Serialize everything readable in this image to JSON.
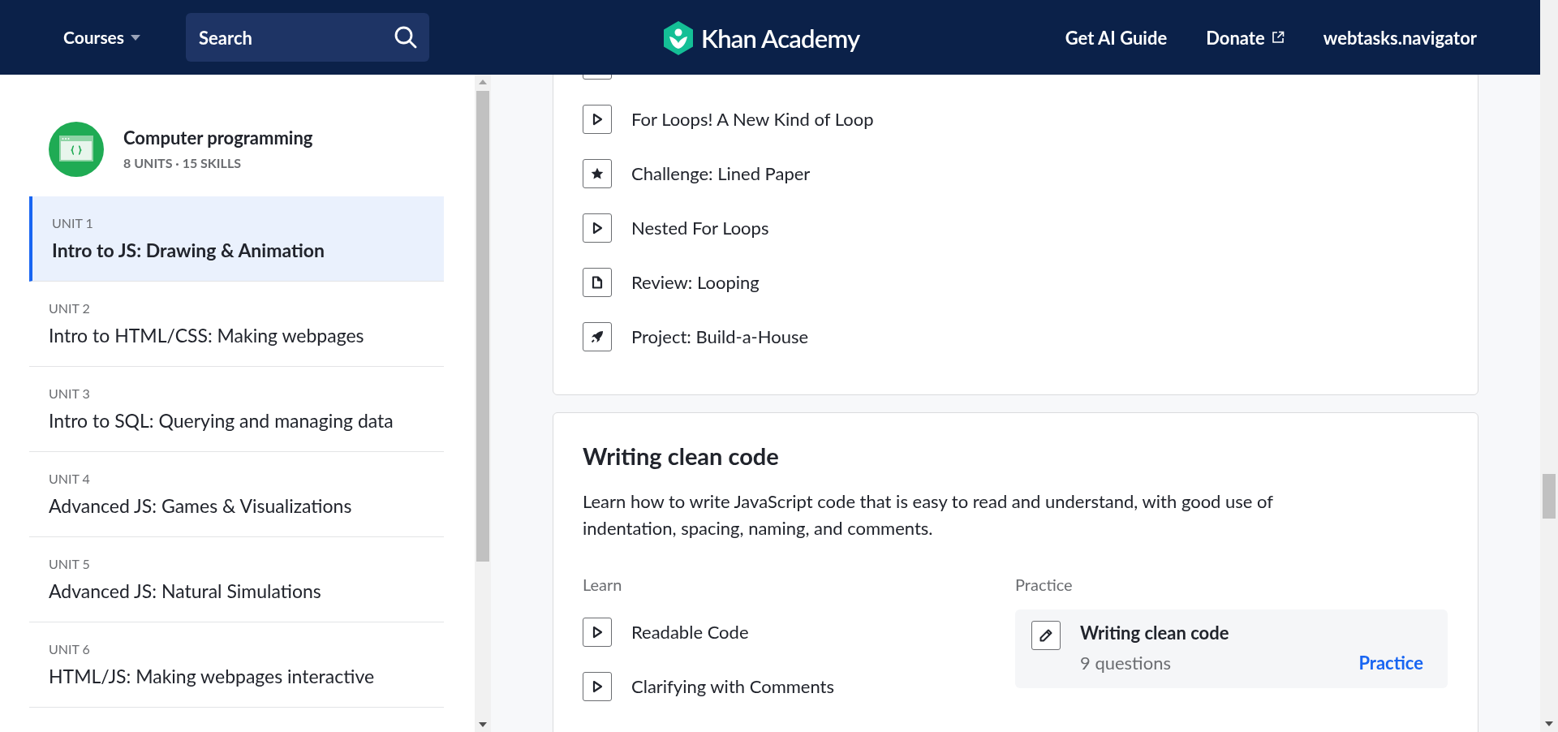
{
  "header": {
    "courses_label": "Courses",
    "search": {
      "placeholder": "Search"
    },
    "logo_text": "Khan Academy",
    "links": [
      {
        "label": "Get AI Guide",
        "external": false
      },
      {
        "label": "Donate",
        "external": true
      },
      {
        "label": "webtasks.navigator",
        "external": false
      }
    ]
  },
  "sidebar": {
    "course_title": "Computer programming",
    "course_meta": "8 UNITS · 15 SKILLS",
    "units": [
      {
        "label": "UNIT 1",
        "title": "Intro to JS: Drawing & Animation",
        "selected": true
      },
      {
        "label": "UNIT 2",
        "title": "Intro to HTML/CSS: Making webpages",
        "selected": false
      },
      {
        "label": "UNIT 3",
        "title": "Intro to SQL: Querying and managing data",
        "selected": false
      },
      {
        "label": "UNIT 4",
        "title": "Advanced JS: Games & Visualizations",
        "selected": false
      },
      {
        "label": "UNIT 5",
        "title": "Advanced JS: Natural Simulations",
        "selected": false
      },
      {
        "label": "UNIT 6",
        "title": "HTML/JS: Making webpages interactive",
        "selected": false
      }
    ]
  },
  "lesson_card": {
    "items": [
      {
        "kind": "video",
        "title": "For Loops! A New Kind of Loop"
      },
      {
        "kind": "challenge",
        "title": "Challenge: Lined Paper"
      },
      {
        "kind": "video",
        "title": "Nested For Loops"
      },
      {
        "kind": "article",
        "title": "Review: Looping"
      },
      {
        "kind": "project",
        "title": "Project: Build-a-House"
      }
    ]
  },
  "section": {
    "title": "Writing clean code",
    "description": "Learn how to write JavaScript code that is easy to read and understand, with good use of indentation, spacing, naming, and comments.",
    "learn_heading": "Learn",
    "learn_items": [
      {
        "kind": "video",
        "title": "Readable Code"
      },
      {
        "kind": "video",
        "title": "Clarifying with Comments"
      }
    ],
    "practice_heading": "Practice",
    "practice": {
      "title": "Writing clean code",
      "meta": "9 questions",
      "action": "Practice"
    }
  }
}
